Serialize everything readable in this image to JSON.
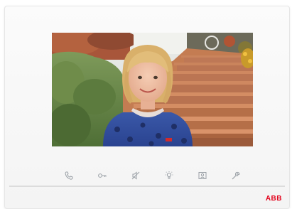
{
  "device": {
    "brand": "ABB",
    "accent_color": "#e2001a"
  },
  "video_feed": {
    "subject": "girl-on-stairs"
  },
  "controls": [
    {
      "name": "phone-icon"
    },
    {
      "name": "key-icon"
    },
    {
      "name": "mute-icon"
    },
    {
      "name": "light-icon"
    },
    {
      "name": "surveillance-icon"
    },
    {
      "name": "settings-icon"
    }
  ]
}
